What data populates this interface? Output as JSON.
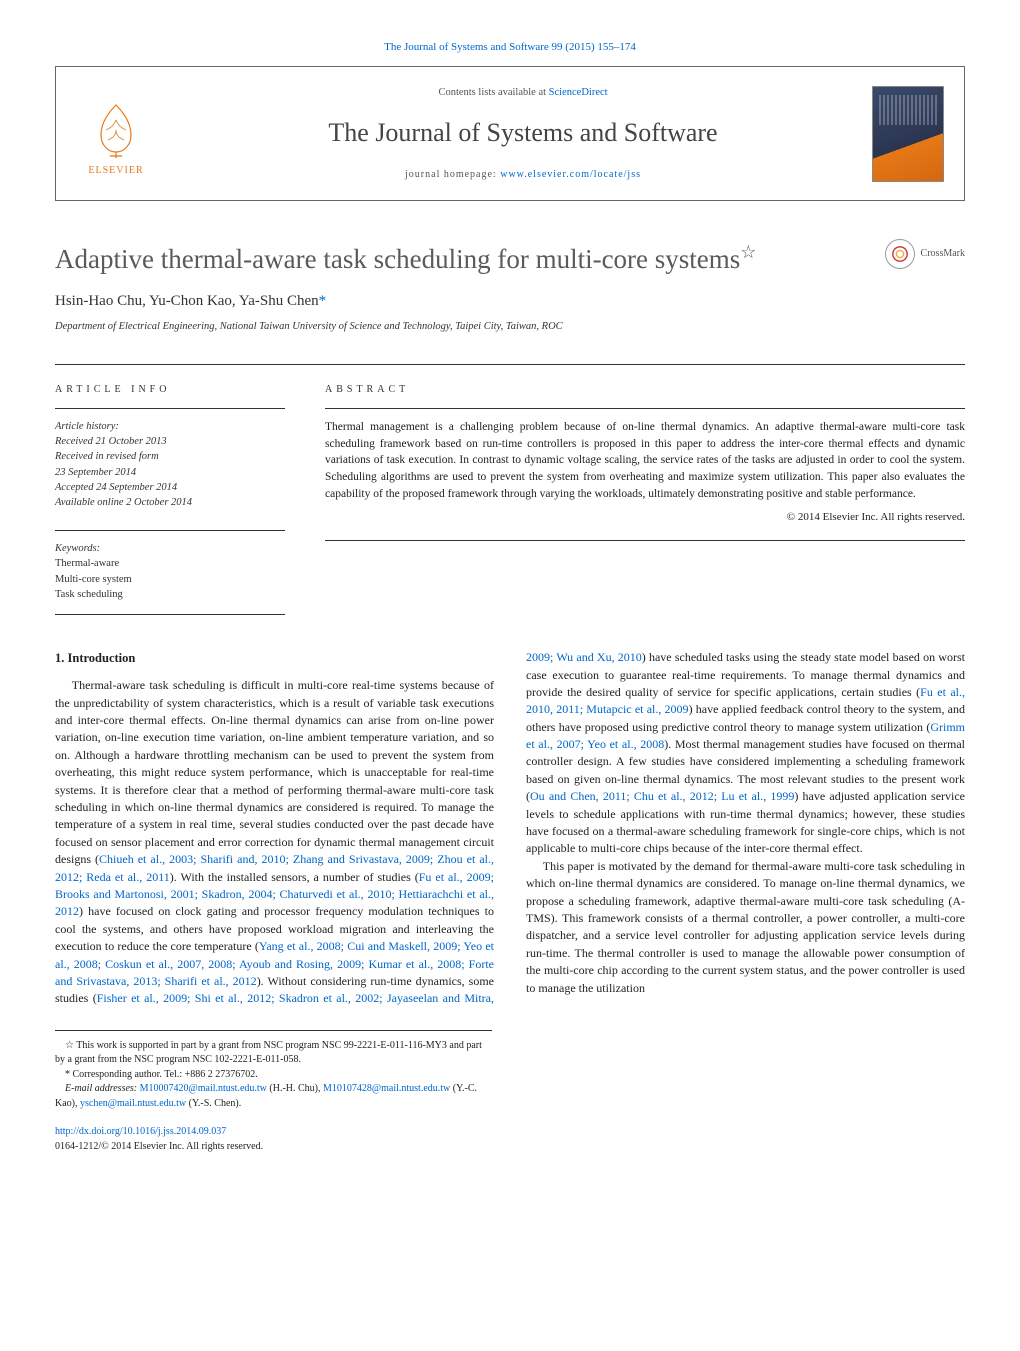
{
  "header": {
    "citation": "The Journal of Systems and Software 99 (2015) 155–174",
    "contents_prefix": "Contents lists available at ",
    "contents_link": "ScienceDirect",
    "journal_title": "The Journal of Systems and Software",
    "homepage_prefix": "journal homepage: ",
    "homepage_link": "www.elsevier.com/locate/jss",
    "elsevier": "ELSEVIER"
  },
  "crossmark": {
    "label": "CrossMark"
  },
  "article": {
    "title": "Adaptive thermal-aware task scheduling for multi-core systems",
    "title_star": "☆",
    "authors": "Hsin-Hao Chu, Yu-Chon Kao, Ya-Shu Chen",
    "corr_mark": "*",
    "affiliation": "Department of Electrical Engineering, National Taiwan University of Science and Technology, Taipei City, Taiwan, ROC"
  },
  "info": {
    "heading": "ARTICLE INFO",
    "history_label": "Article history:",
    "history": [
      "Received 21 October 2013",
      "Received in revised form",
      "23 September 2014",
      "Accepted 24 September 2014",
      "Available online 2 October 2014"
    ],
    "keywords_label": "Keywords:",
    "keywords": [
      "Thermal-aware",
      "Multi-core system",
      "Task scheduling"
    ]
  },
  "abstract": {
    "heading": "ABSTRACT",
    "text": "Thermal management is a challenging problem because of on-line thermal dynamics. An adaptive thermal-aware multi-core task scheduling framework based on run-time controllers is proposed in this paper to address the inter-core thermal effects and dynamic variations of task execution. In contrast to dynamic voltage scaling, the service rates of the tasks are adjusted in order to cool the system. Scheduling algorithms are used to prevent the system from overheating and maximize system utilization. This paper also evaluates the capability of the proposed framework through varying the workloads, ultimately demonstrating positive and stable performance.",
    "copyright": "© 2014 Elsevier Inc. All rights reserved."
  },
  "body": {
    "section1_heading": "1.  Introduction",
    "para1a": "Thermal-aware task scheduling is difficult in multi-core real-time systems because of the unpredictability of system characteristics, which is a result of variable task executions and inter-core thermal effects. On-line thermal dynamics can arise from on-line power variation, on-line execution time variation, on-line ambient temperature variation, and so on. Although a hardware throttling mechanism can be used to prevent the system from overheating, this might reduce system performance, which is unacceptable for real-time systems. It is therefore clear that a method of performing thermal-aware multi-core task scheduling in which on-line thermal dynamics are considered is required. To manage the temperature of a system in real time, several studies conducted over the past decade have focused on sensor placement and error correction for dynamic thermal management circuit designs (",
    "cite1": "Chiueh et al., 2003; Sharifi and, 2010; Zhang and Srivastava, 2009; Zhou et al., 2012; Reda et al., 2011",
    "para1b": "). With the installed sensors, a number of studies (",
    "cite2": "Fu et al., 2009; Brooks and Martonosi, 2001; Skadron, 2004; Chaturvedi et al., 2010; Hettiarachchi et al., 2012",
    "para1c": ") have focused on clock gating and processor frequency modulation techniques to cool the systems, and others have proposed workload migration and interleaving the execution to reduce the core temperature (",
    "cite3": "Yang et al., 2008; Cui and Maskell, 2009; Yeo et al., 2008; Coskun et al., 2007, 2008; Ayoub and Rosing, 2009; Kumar et al., 2008; Forte and Srivastava, 2013; Sharifi et al., 2012",
    "para1d": "). Without considering run-time dynamics, some studies (",
    "cite4": "Fisher et al., 2009; Shi et al., 2012; Skadron et al., 2002; Jayaseelan and Mitra, 2009; Wu and Xu, 2010",
    "para1e": ") have scheduled tasks using the steady state model based on worst case execution to guarantee real-time requirements. To manage thermal dynamics and provide the desired quality of service for specific applications, certain studies (",
    "cite5": "Fu et al., 2010, 2011; Mutapcic et al., 2009",
    "para1f": ") have applied feedback control theory to the system, and others have proposed using predictive control theory to manage system utilization (",
    "cite6": "Grimm et al., 2007; Yeo et al., 2008",
    "para1g": "). Most thermal management studies have focused on thermal controller design. A few studies have considered implementing a scheduling framework based on given on-line thermal dynamics. The most relevant studies to the present work (",
    "cite7": "Ou and Chen, 2011; Chu et al., 2012; Lu et al., 1999",
    "para1h": ") have adjusted application service levels to schedule applications with run-time thermal dynamics; however, these studies have focused on a thermal-aware scheduling framework for single-core chips, which is not applicable to multi-core chips because of the inter-core thermal effect.",
    "para2": "This paper is motivated by the demand for thermal-aware multi-core task scheduling in which on-line thermal dynamics are considered. To manage on-line thermal dynamics, we propose a scheduling framework, adaptive thermal-aware multi-core task scheduling (A-TMS). This framework consists of a thermal controller, a power controller, a multi-core dispatcher, and a service level controller for adjusting application service levels during run-time. The thermal controller is used to manage the allowable power consumption of the multi-core chip according to the current system status, and the power controller is used to manage the utilization"
  },
  "footnotes": {
    "funding_mark": "☆",
    "funding": " This work is supported in part by a grant from NSC program NSC 99-2221-E-011-116-MY3 and part by a grant from the NSC program NSC 102-2221-E-011-058.",
    "corr_mark": "*",
    "corr": " Corresponding author. Tel.: +886 2 27376702.",
    "email_label": "E-mail addresses: ",
    "email1": "M10007420@mail.ntust.edu.tw",
    "email1_who": " (H.-H. Chu), ",
    "email2": "M10107428@mail.ntust.edu.tw",
    "email2_who": " (Y.-C. Kao), ",
    "email3": "yschen@mail.ntust.edu.tw",
    "email3_who": "(Y.-S. Chen)."
  },
  "doi": {
    "link": "http://dx.doi.org/10.1016/j.jss.2014.09.037",
    "issn_line": "0164-1212/© 2014 Elsevier Inc. All rights reserved."
  }
}
